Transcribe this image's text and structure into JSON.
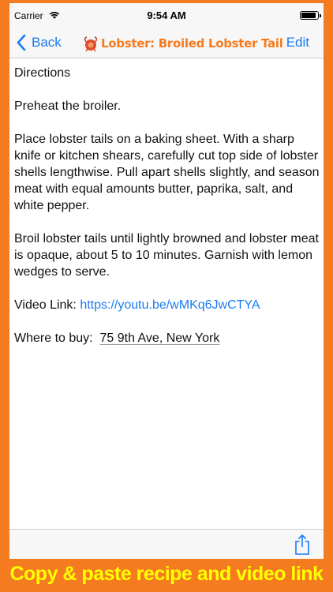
{
  "status_bar": {
    "carrier": "Carrier",
    "time": "9:54 AM"
  },
  "nav": {
    "back_label": "Back",
    "title": "Lobster: Broiled Lobster Tail",
    "edit_label": "Edit"
  },
  "recipe": {
    "heading": "Directions",
    "steps": [
      "Preheat the broiler.",
      "Place lobster tails on a baking sheet. With a sharp knife or kitchen shears, carefully cut top side of lobster shells lengthwise. Pull apart shells slightly, and season meat with equal amounts butter, paprika, salt, and white pepper.",
      "Broil lobster tails until lightly browned and lobster meat is opaque, about 5 to 10 minutes. Garnish with lemon wedges to serve."
    ],
    "video_label": "Video Link: ",
    "video_url": "https://youtu.be/wMKq6JwCTYA",
    "buy_label": "Where to buy:  ",
    "buy_address": "75 9th Ave, New York"
  },
  "caption": "Copy & paste recipe and video link",
  "colors": {
    "accent_orange": "#F47B20",
    "ios_blue": "#1a7cf0",
    "caption_yellow": "#FFFF00"
  }
}
